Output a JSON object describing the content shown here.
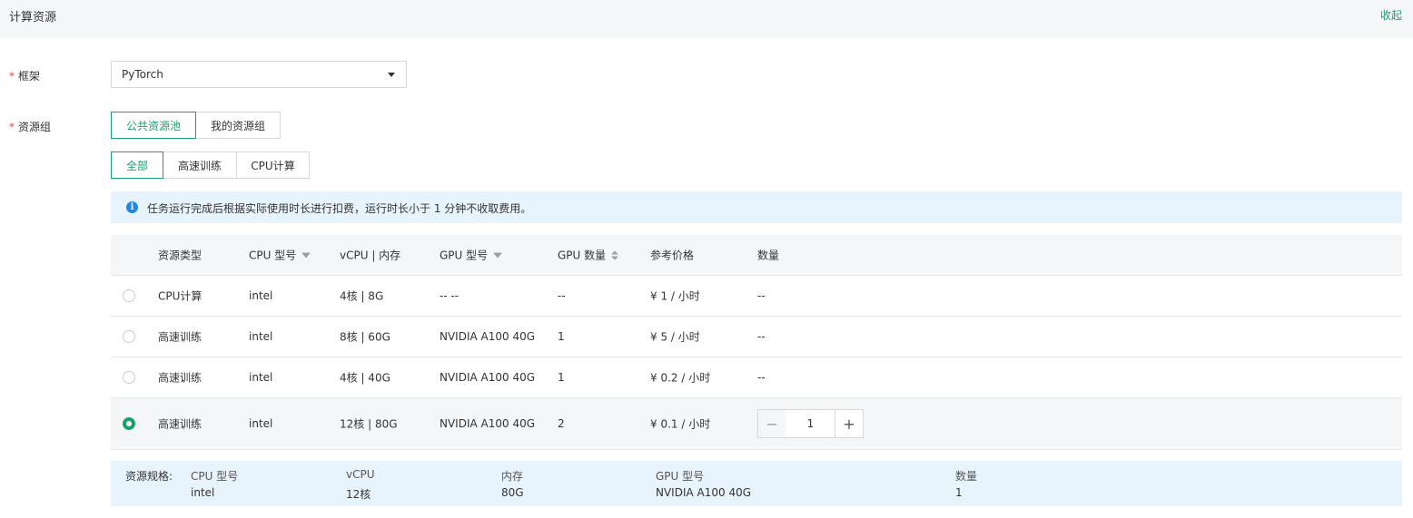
{
  "header": {
    "title": "计算资源",
    "collapse": "收起"
  },
  "framework": {
    "label": "框架",
    "required": "*",
    "value": "PyTorch"
  },
  "resource_group": {
    "label": "资源组",
    "required": "*",
    "pool_tabs": [
      {
        "label": "公共资源池",
        "active": true
      },
      {
        "label": "我的资源组",
        "active": false
      }
    ],
    "filter_tabs": [
      {
        "label": "全部",
        "active": true
      },
      {
        "label": "高速训练",
        "active": false
      },
      {
        "label": "CPU计算",
        "active": false
      }
    ]
  },
  "notice": {
    "icon": "info-icon",
    "text": "任务运行完成后根据实际使用时长进行扣费，运行时长小于 1 分钟不收取费用。"
  },
  "table": {
    "columns": [
      "资源类型",
      "CPU 型号",
      "vCPU | 内存",
      "GPU 型号",
      "GPU 数量",
      "参考价格",
      "数量"
    ],
    "rows": [
      {
        "type": "CPU计算",
        "cpu": "intel",
        "vcpu": "4核 | 8G",
        "gpu": "-- --",
        "gpu_count": "--",
        "price": "¥ 1 / 小时",
        "qty": "--",
        "selected": false
      },
      {
        "type": "高速训练",
        "cpu": "intel",
        "vcpu": "8核 | 60G",
        "gpu": "NVIDIA A100 40G",
        "gpu_count": "1",
        "price": "¥ 5 / 小时",
        "qty": "--",
        "selected": false
      },
      {
        "type": "高速训练",
        "cpu": "intel",
        "vcpu": "4核 | 40G",
        "gpu": "NVIDIA A100 40G",
        "gpu_count": "1",
        "price": "¥ 0.2 / 小时",
        "qty": "--",
        "selected": false
      },
      {
        "type": "高速训练",
        "cpu": "intel",
        "vcpu": "12核 | 80G",
        "gpu": "NVIDIA A100 40G",
        "gpu_count": "2",
        "price": "¥ 0.1 / 小时",
        "qty": "1",
        "selected": true
      }
    ],
    "stepper": {
      "minus": "−",
      "plus": "+"
    }
  },
  "spec": {
    "label": "资源规格:",
    "columns": [
      {
        "head": "CPU 型号",
        "value": "intel"
      },
      {
        "head": "vCPU",
        "value": "12核"
      },
      {
        "head": "内存",
        "value": "80G"
      },
      {
        "head": "GPU 型号",
        "value": "NVIDIA A100 40G"
      },
      {
        "head": "数量",
        "value": "1"
      }
    ]
  },
  "colors": {
    "accent": "#16a36b",
    "info_bg": "#e8f4fd",
    "info_icon": "#1e88e5",
    "required": "#e34d4d"
  }
}
